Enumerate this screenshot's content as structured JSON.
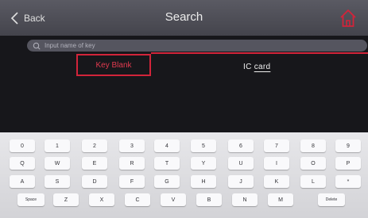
{
  "header": {
    "back_label": "Back",
    "title": "Search",
    "accent_color": "#d2243a"
  },
  "search": {
    "placeholder": "Input name of key"
  },
  "tabs": [
    {
      "label": "Key Blank",
      "selected": true
    },
    {
      "label": "IC card",
      "selected": false
    }
  ],
  "keyboard": {
    "row1": [
      "0",
      "1",
      "2",
      "3",
      "4",
      "5",
      "6",
      "7",
      "8",
      "9"
    ],
    "row2": [
      "Q",
      "W",
      "E",
      "R",
      "T",
      "Y",
      "U",
      "I",
      "O",
      "P"
    ],
    "row3": [
      "A",
      "S",
      "D",
      "F",
      "G",
      "H",
      "J",
      "K",
      "L",
      "*"
    ],
    "row4": [
      "Space",
      "Z",
      "X",
      "C",
      "V",
      "B",
      "N",
      "M",
      "Delete"
    ]
  }
}
